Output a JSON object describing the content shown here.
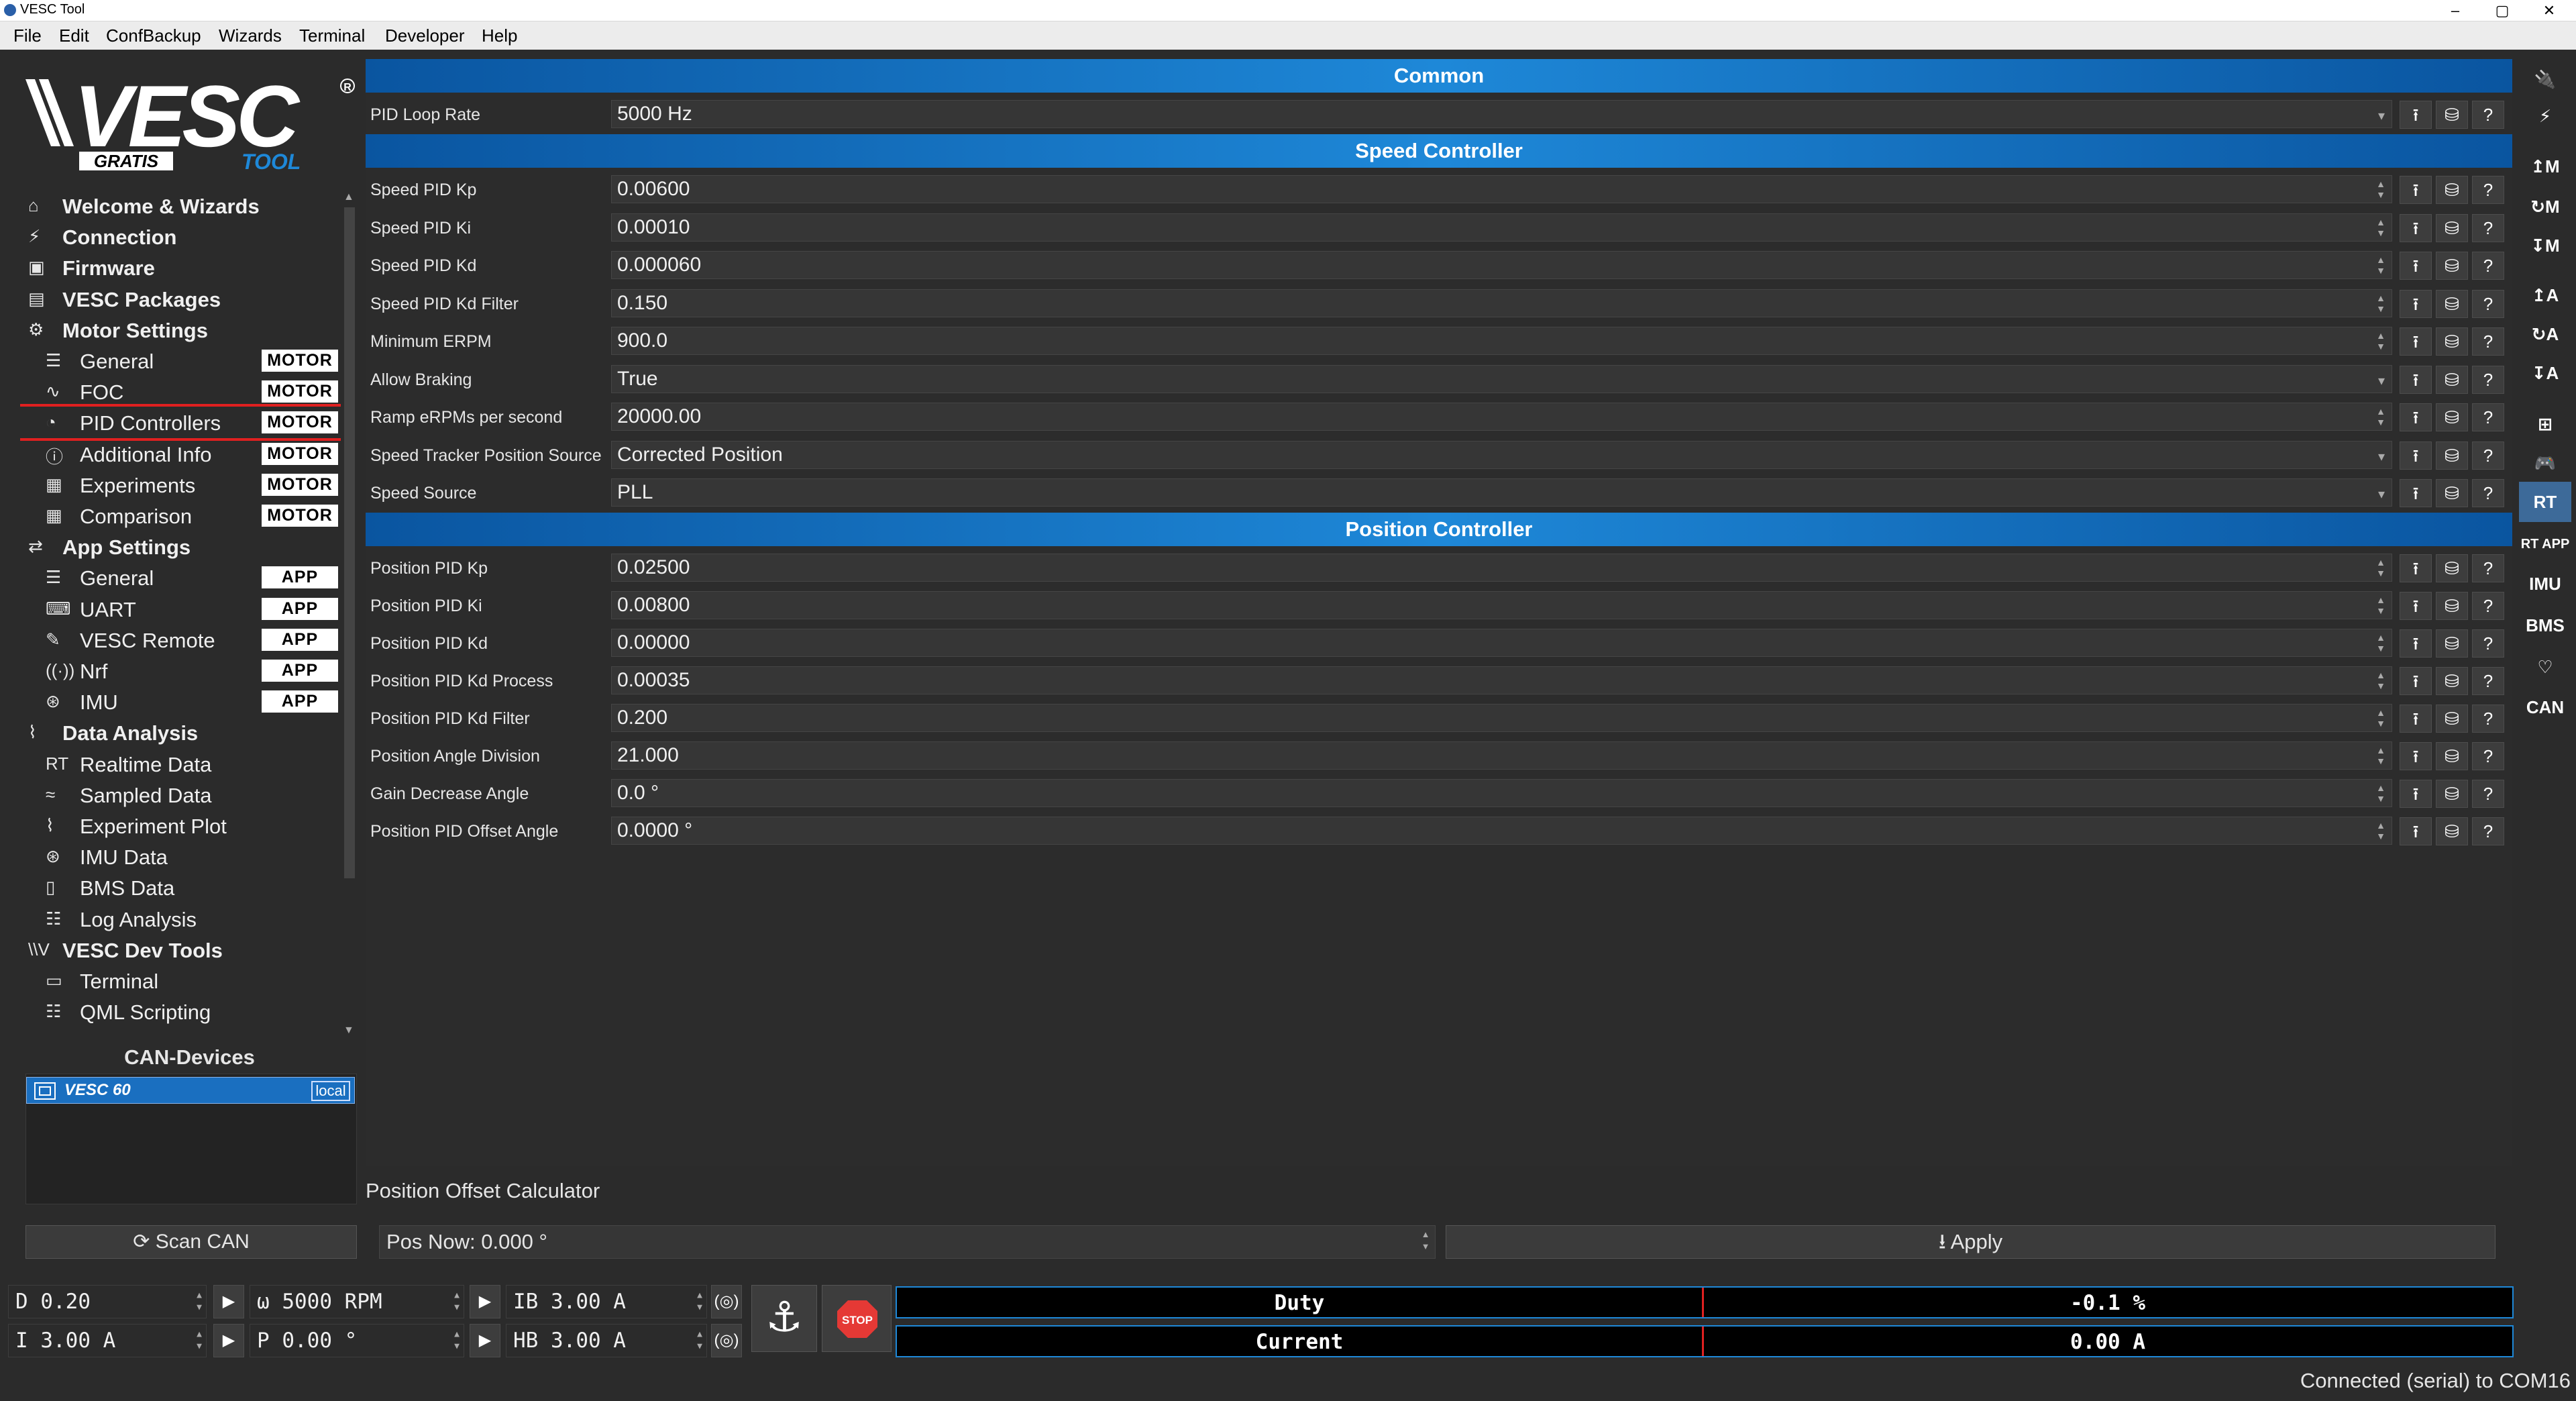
{
  "window": {
    "title": "VESC Tool"
  },
  "menu": [
    "File",
    "Edit",
    "ConfBackup",
    "Wizards",
    "Terminal",
    "Developer",
    "Help"
  ],
  "logo": {
    "text": "VESC",
    "badge": "GRATIS",
    "sub": "TOOL"
  },
  "nav": [
    {
      "label": "Welcome & Wizards",
      "level": "top",
      "icon": "home-icon"
    },
    {
      "label": "Connection",
      "level": "top",
      "icon": "plug-icon"
    },
    {
      "label": "Firmware",
      "level": "top",
      "icon": "chip-icon"
    },
    {
      "label": "VESC Packages",
      "level": "top",
      "icon": "package-icon"
    },
    {
      "label": "Motor Settings",
      "level": "top",
      "icon": "motor-icon"
    },
    {
      "label": "General",
      "level": "sub",
      "badge": "MOTOR",
      "icon": "sliders-icon"
    },
    {
      "label": "FOC",
      "level": "sub",
      "badge": "MOTOR",
      "icon": "coil-icon"
    },
    {
      "label": "PID Controllers",
      "level": "sub",
      "badge": "MOTOR",
      "icon": "gauge-icon",
      "selected": true
    },
    {
      "label": "Additional Info",
      "level": "sub",
      "badge": "MOTOR",
      "icon": "info-icon"
    },
    {
      "label": "Experiments",
      "level": "sub",
      "badge": "MOTOR",
      "icon": "calculator-icon"
    },
    {
      "label": "Comparison",
      "level": "sub",
      "badge": "MOTOR",
      "icon": "calculator-icon"
    },
    {
      "label": "App Settings",
      "level": "top",
      "icon": "app-icon"
    },
    {
      "label": "General",
      "level": "sub",
      "badge": "APP",
      "icon": "sliders-icon"
    },
    {
      "label": "UART",
      "level": "sub",
      "badge": "APP",
      "icon": "keyboard-icon"
    },
    {
      "label": "VESC Remote",
      "level": "sub",
      "badge": "APP",
      "icon": "remote-icon"
    },
    {
      "label": "Nrf",
      "level": "sub",
      "badge": "APP",
      "icon": "wireless-icon"
    },
    {
      "label": "IMU",
      "level": "sub",
      "badge": "APP",
      "icon": "imu-icon"
    },
    {
      "label": "Data Analysis",
      "level": "top",
      "icon": "chart-icon"
    },
    {
      "label": "Realtime Data",
      "level": "sub",
      "icon": "realtime-icon"
    },
    {
      "label": "Sampled Data",
      "level": "sub",
      "icon": "sampled-icon"
    },
    {
      "label": "Experiment Plot",
      "level": "sub",
      "icon": "plot-icon"
    },
    {
      "label": "IMU Data",
      "level": "sub",
      "icon": "imu-icon"
    },
    {
      "label": "BMS Data",
      "level": "sub",
      "icon": "battery-icon"
    },
    {
      "label": "Log Analysis",
      "level": "sub",
      "icon": "log-icon"
    },
    {
      "label": "VESC Dev Tools",
      "level": "top",
      "icon": "vesc-icon"
    },
    {
      "label": "Terminal",
      "level": "sub",
      "icon": "terminal-icon"
    },
    {
      "label": "QML Scripting",
      "level": "sub",
      "icon": "script-icon"
    }
  ],
  "can": {
    "title": "CAN-Devices",
    "device": "VESC 60",
    "badge": "local",
    "scan_label": "Scan CAN"
  },
  "sections": {
    "common": "Common",
    "speed": "Speed Controller",
    "position": "Position Controller"
  },
  "params": [
    {
      "name": "PID Loop Rate",
      "value": "5000 Hz",
      "kind": "combo"
    },
    {
      "name": "Speed PID Kp",
      "value": "0.00600",
      "kind": "spin"
    },
    {
      "name": "Speed PID Ki",
      "value": "0.00010",
      "kind": "spin"
    },
    {
      "name": "Speed PID Kd",
      "value": "0.000060",
      "kind": "spin"
    },
    {
      "name": "Speed PID Kd Filter",
      "value": "0.150",
      "kind": "spin"
    },
    {
      "name": "Minimum ERPM",
      "value": "900.0",
      "kind": "spin"
    },
    {
      "name": "Allow Braking",
      "value": "True",
      "kind": "combo"
    },
    {
      "name": "Ramp eRPMs per second",
      "value": "20000.00",
      "kind": "spin"
    },
    {
      "name": "Speed Tracker Position Source",
      "value": "Corrected Position",
      "kind": "combo"
    },
    {
      "name": "Speed Source",
      "value": "PLL",
      "kind": "combo"
    },
    {
      "name": "Position PID Kp",
      "value": "0.02500",
      "kind": "spin"
    },
    {
      "name": "Position PID Ki",
      "value": "0.00800",
      "kind": "spin"
    },
    {
      "name": "Position PID Kd",
      "value": "0.00000",
      "kind": "spin"
    },
    {
      "name": "Position PID Kd Process",
      "value": "0.00035",
      "kind": "spin"
    },
    {
      "name": "Position PID Kd Filter",
      "value": "0.200",
      "kind": "spin"
    },
    {
      "name": "Position Angle Division",
      "value": "21.000",
      "kind": "spin"
    },
    {
      "name": "Gain Decrease Angle",
      "value": "0.0 °",
      "kind": "spin"
    },
    {
      "name": "Position PID Offset Angle",
      "value": "0.0000 °",
      "kind": "spin"
    }
  ],
  "pos_calc": {
    "title": "Position Offset Calculator",
    "pos_now": "Pos Now: 0.000 °",
    "apply_label": "Apply"
  },
  "controls": {
    "duty": "D 0.20",
    "current": "I 3.00 A",
    "rpm": "ω 5000 RPM",
    "pos": "P 0.00 °",
    "brake": "IB 3.00 A",
    "handbrake": "HB 3.00 A",
    "stop": "STOP"
  },
  "bars": [
    {
      "label": "Duty",
      "value": "-0.1 %"
    },
    {
      "label": "Current",
      "value": "0.00 A"
    }
  ],
  "status": "Connected (serial) to COM16",
  "right_toolbar": [
    {
      "icon": "connect-icon",
      "text": ""
    },
    {
      "icon": "disconnect-icon",
      "text": ""
    },
    {
      "icon": "read-motor-icon",
      "text": "↥M"
    },
    {
      "icon": "reset-motor-icon",
      "text": "↻M"
    },
    {
      "icon": "write-motor-icon",
      "text": "↧M"
    },
    {
      "icon": "read-app-icon",
      "text": "↥A"
    },
    {
      "icon": "reset-app-icon",
      "text": "↻A"
    },
    {
      "icon": "write-app-icon",
      "text": "↧A"
    },
    {
      "icon": "can-fwd-icon",
      "text": ""
    },
    {
      "icon": "gamepad-icon",
      "text": ""
    },
    {
      "icon": "rt-data-icon",
      "text": "RT"
    },
    {
      "icon": "rt-app-icon",
      "text": "RT APP"
    },
    {
      "icon": "imu-icon",
      "text": "IMU"
    },
    {
      "icon": "bms-icon",
      "text": "BMS"
    },
    {
      "icon": "heart-icon",
      "text": "♡"
    },
    {
      "icon": "can-icon",
      "text": "CAN"
    }
  ]
}
